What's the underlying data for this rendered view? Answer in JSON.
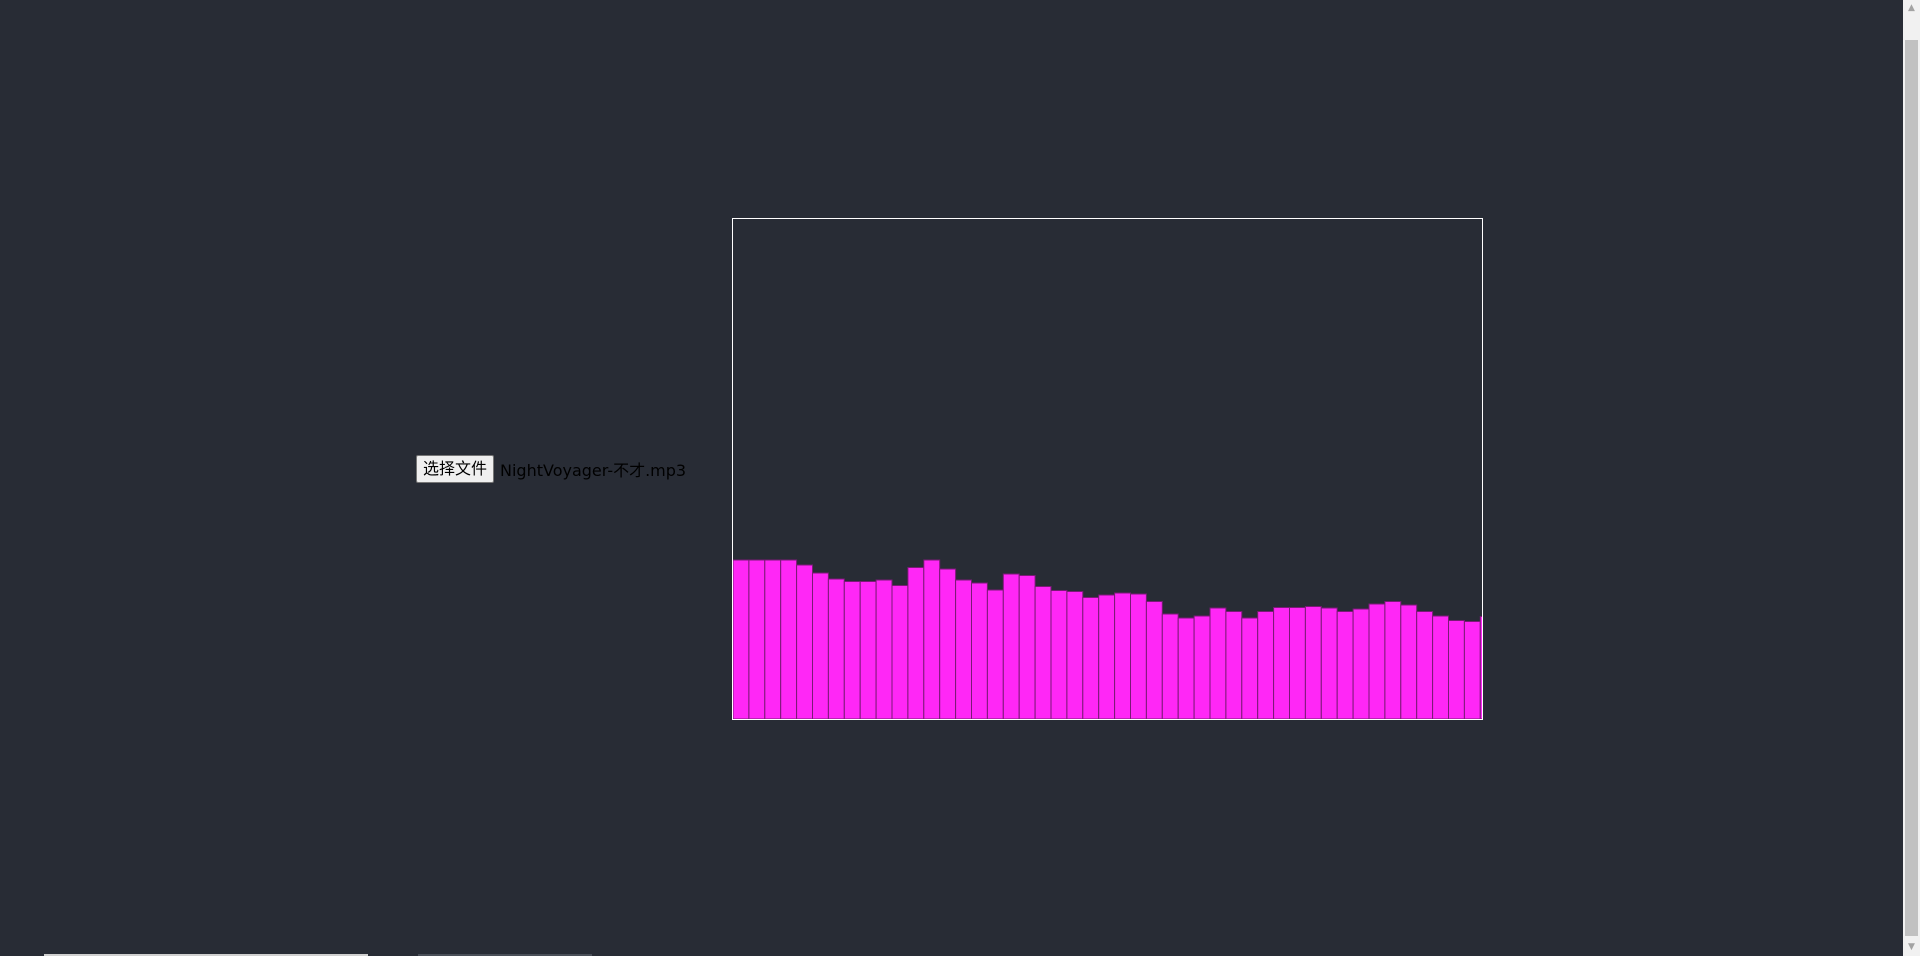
{
  "file_input": {
    "button_label": "选择文件",
    "file_name": "NightVoyager-不才.mp3"
  },
  "colors": {
    "background": "#282c35",
    "bar_fill": "#ff27f6",
    "bar_stroke": "#7a1a76",
    "canvas_border": "#ffffff"
  },
  "scrollbar": {
    "up_arrow_icon": "▲",
    "down_arrow_icon": "▼"
  },
  "chart_data": {
    "type": "bar",
    "title": "",
    "xlabel": "",
    "ylabel": "",
    "ylim": [
      0,
      1
    ],
    "values": [
      0.318,
      0.318,
      0.318,
      0.318,
      0.308,
      0.292,
      0.28,
      0.275,
      0.275,
      0.278,
      0.267,
      0.303,
      0.318,
      0.3,
      0.278,
      0.272,
      0.258,
      0.29,
      0.287,
      0.265,
      0.257,
      0.255,
      0.243,
      0.248,
      0.252,
      0.25,
      0.235,
      0.21,
      0.202,
      0.206,
      0.222,
      0.215,
      0.202,
      0.215,
      0.223,
      0.223,
      0.225,
      0.222,
      0.215,
      0.22,
      0.23,
      0.235,
      0.228,
      0.215,
      0.206,
      0.197,
      0.195,
      0.205
    ]
  }
}
